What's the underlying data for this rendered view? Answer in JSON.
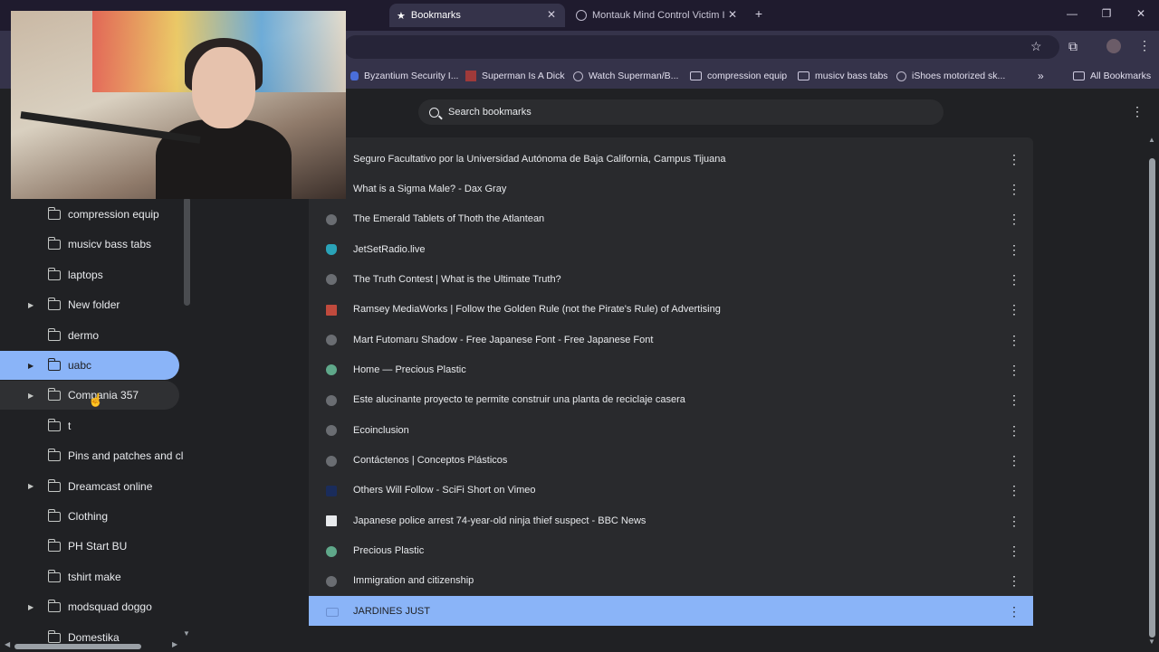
{
  "tabs": [
    {
      "label": "",
      "active": false
    },
    {
      "label": "Bookmarks",
      "active": true
    },
    {
      "label": "Montauk Mind Control Victim I",
      "active": false
    }
  ],
  "bookmarks_bar": [
    {
      "label": "Byzantium Security I...",
      "icon": "bell-icon"
    },
    {
      "label": "Superman Is A Dick",
      "icon": "square-icon"
    },
    {
      "label": "Watch Superman/B...",
      "icon": "globe-icon"
    },
    {
      "label": "compression equip",
      "icon": "folder-icon"
    },
    {
      "label": "musicv bass tabs",
      "icon": "folder-icon"
    },
    {
      "label": "iShoes motorized sk...",
      "icon": "globe-icon"
    },
    {
      "label": "All Bookmarks",
      "icon": "folder-icon"
    }
  ],
  "search": {
    "placeholder": "Search bookmarks"
  },
  "sidebar": {
    "items": [
      {
        "label": "compression equip",
        "expandable": false
      },
      {
        "label": "musicv bass tabs",
        "expandable": false
      },
      {
        "label": "laptops",
        "expandable": false
      },
      {
        "label": "New folder",
        "expandable": true
      },
      {
        "label": "dermo",
        "expandable": false
      },
      {
        "label": "uabc",
        "expandable": true,
        "selected": true
      },
      {
        "label": "Compania 357",
        "expandable": true,
        "hover": true
      },
      {
        "label": "t",
        "expandable": false
      },
      {
        "label": "Pins and patches and cl",
        "expandable": false
      },
      {
        "label": "Dreamcast online",
        "expandable": true
      },
      {
        "label": "Clothing",
        "expandable": false
      },
      {
        "label": "PH Start BU",
        "expandable": false
      },
      {
        "label": "tshirt make",
        "expandable": false
      },
      {
        "label": "modsquad doggo",
        "expandable": true
      },
      {
        "label": "Domestika",
        "expandable": false
      }
    ]
  },
  "list": {
    "rows": [
      {
        "title": "Seguro Facultativo por la Universidad Autónoma de Baja California, Campus Tijuana",
        "favicon": "none"
      },
      {
        "title": "What is a Sigma Male? - Dax Gray",
        "favicon": "none"
      },
      {
        "title": "The Emerald Tablets of Thoth the Atlantean",
        "favicon": "globe"
      },
      {
        "title": "JetSetRadio.live",
        "favicon": "t"
      },
      {
        "title": "The Truth Contest | What is the Ultimate Truth?",
        "favicon": "globe"
      },
      {
        "title": "Ramsey MediaWorks | Follow the Golden Rule (not the Pirate's Rule) of Advertising",
        "favicon": "r"
      },
      {
        "title": "Mart Futomaru Shadow - Free Japanese Font - Free Japanese Font",
        "favicon": "globe"
      },
      {
        "title": "Home — Precious Plastic",
        "favicon": "g"
      },
      {
        "title": "Este alucinante proyecto te permite construir una planta de reciclaje casera",
        "favicon": "globe"
      },
      {
        "title": "Ecoinclusion",
        "favicon": "globe"
      },
      {
        "title": "Contáctenos | Conceptos Plásticos",
        "favicon": "globe"
      },
      {
        "title": "Others Will Follow - SciFi Short on Vimeo",
        "favicon": "v"
      },
      {
        "title": "Japanese police arrest 74-year-old ninja thief suspect - BBC News",
        "favicon": "bbc"
      },
      {
        "title": "Precious Plastic",
        "favicon": "g"
      },
      {
        "title": "Immigration and citizenship",
        "favicon": "globe"
      },
      {
        "title": "JARDINES JUST",
        "favicon": "folder",
        "selected": true
      }
    ]
  },
  "colors": {
    "selected": "#8ab4f8",
    "page_bg": "#202124",
    "list_bg": "#292a2d",
    "chrome_bg": "#35334a"
  }
}
